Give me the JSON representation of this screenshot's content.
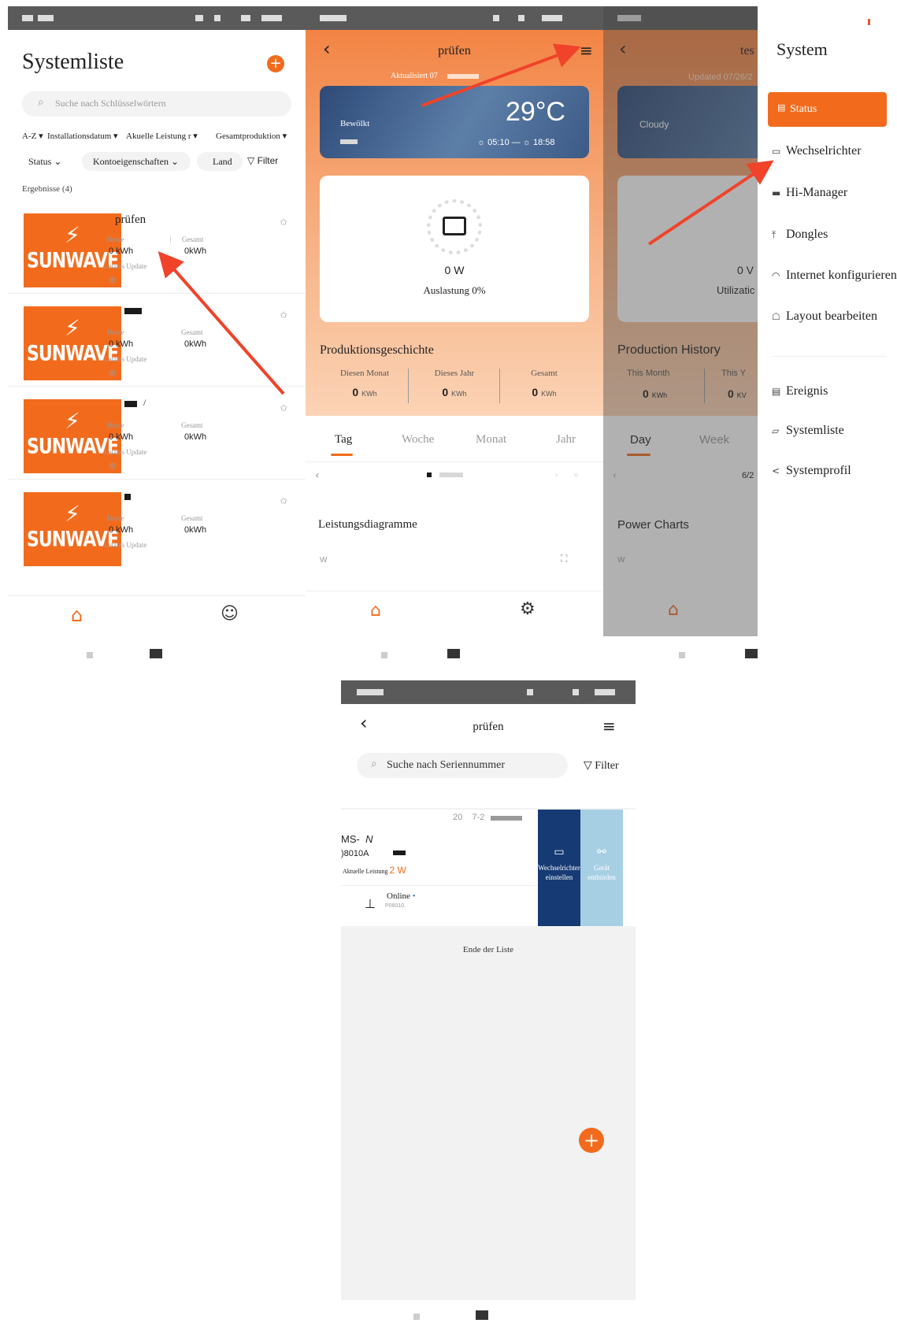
{
  "screen1": {
    "title": "Systemliste",
    "search_placeholder": "Suche nach Schlüsselwörtern",
    "sort": [
      "A-Z",
      "Installationsdatum",
      "Akuelle Leistung r",
      "Gesamtproduktion"
    ],
    "filters": [
      "Status",
      "Kontoeigenschaften",
      "Land",
      "Filter"
    ],
    "results": "Ergebnisse (4)",
    "cards": [
      {
        "name": "prüfen",
        "today_label": "Heute",
        "today_value": "0 kWh",
        "total_label": "Gesamt",
        "total_value": "0kWh",
        "update_label": "Letztes Update"
      },
      {
        "name": "",
        "today_label": "Heute",
        "today_value": "0 kWh",
        "total_label": "Gesamt",
        "total_value": "0kWh",
        "update_label": "Letztes Update"
      },
      {
        "name": "/",
        "today_label": "Heute",
        "today_value": "0 kWh",
        "total_label": "Gesamt",
        "total_value": "0kWh",
        "update_label": "Letztes Update"
      },
      {
        "name": "",
        "today_label": "Heute",
        "today_value": "0 kWh",
        "total_label": "Gesamt",
        "total_value": "0kWh",
        "update_label": "Letztes Update"
      }
    ],
    "brand": "SUNWAVE",
    "accent": "#f26b1d"
  },
  "screen2": {
    "title": "prüfen",
    "updated": "Aktualisiert 07",
    "weather_label": "Bewölkt",
    "temperature": "29°C",
    "sunrise": "05:10",
    "sunset": "18:58",
    "power": "0 W",
    "utilization": "Auslastung 0%",
    "history_title": "Produktionsgeschichte",
    "history": [
      {
        "label": "Diesen Monat",
        "value": "0",
        "unit": "KWh"
      },
      {
        "label": "Dieses Jahr",
        "value": "0",
        "unit": "KWh"
      },
      {
        "label": "Gesamt",
        "value": "0",
        "unit": "KWh"
      }
    ],
    "tabs": [
      "Tag",
      "Woche",
      "Monat",
      "Jahr"
    ],
    "charts_title": "Leistungsdiagramme",
    "unit": "W"
  },
  "screen3": {
    "title": "tes",
    "updated": "Updated 07/26/2",
    "weather_label": "Cloudy",
    "power": "0 V",
    "utilization": "Utilizatic",
    "history_title": "Production History",
    "history": [
      {
        "label": "This Month",
        "value": "0",
        "unit": "KWh"
      },
      {
        "label": "This Y",
        "value": "0",
        "unit": "KV"
      }
    ],
    "tabs": [
      "Day",
      "Week"
    ],
    "date": "6/2",
    "charts_title": "Power Charts",
    "unit": "W"
  },
  "menu": {
    "title": "System",
    "items": [
      "Status",
      "Wechselrichter",
      "Hi-Manager",
      "Dongles",
      "Internet konfigurieren",
      "Layout bearbeiten"
    ],
    "items2": [
      "Ereignis",
      "Systemliste",
      "Systemprofil"
    ]
  },
  "screen4": {
    "title": "prüfen",
    "search_placeholder": "Suche nach Seriennummer",
    "filter": "Filter",
    "device_date": "20",
    "device_date_tail": "7-2",
    "device_model": "MS-",
    "device_model_tail": "N",
    "device_sn": ")8010A",
    "power_label": "Aktuelle Leistung",
    "power_value": "2 W",
    "status": "Online",
    "status_sn": "P08010.",
    "action1": "Wechselrichter einstellen",
    "action2": "Gerät entbinden",
    "end": "Ende der Liste"
  }
}
